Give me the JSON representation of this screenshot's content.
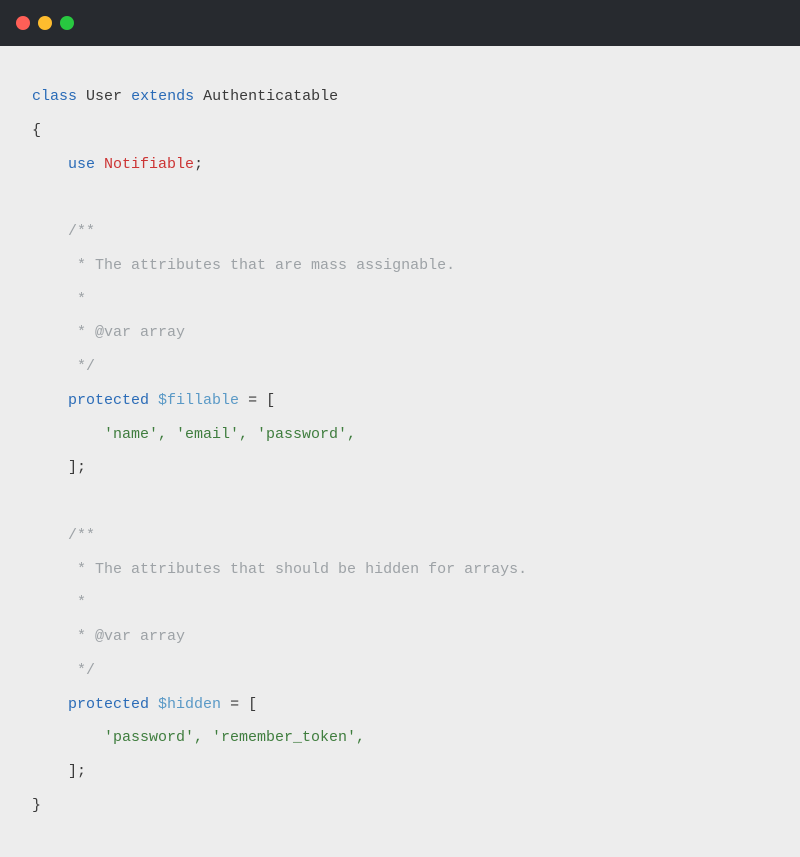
{
  "code": {
    "keyword_class": "class",
    "class_name": "User",
    "keyword_extends": "extends",
    "parent_class": "Authenticatable",
    "brace_open": "{",
    "use_keyword": "use",
    "trait_name": "Notifiable",
    "semicolon": ";",
    "doc1": {
      "open": "/**",
      "l1": " * The attributes that are mass assignable.",
      "l2": " *",
      "l3": " * @var array",
      "close": " */"
    },
    "keyword_protected": "protected",
    "var_fillable": "$fillable",
    "eq_bracket_open": " = [",
    "fillable_vals": "'name', 'email', 'password',",
    "bracket_close": "];",
    "doc2": {
      "open": "/**",
      "l1": " * The attributes that should be hidden for arrays.",
      "l2": " *",
      "l3": " * @var array",
      "close": " */"
    },
    "var_hidden": "$hidden",
    "hidden_vals": "'password', 'remember_token',",
    "brace_close": "}"
  },
  "colors": {
    "titlebar": "#272a2f",
    "bg": "#ededed",
    "red": "#ff5f57",
    "yellow": "#febc2e",
    "green": "#28c840"
  }
}
